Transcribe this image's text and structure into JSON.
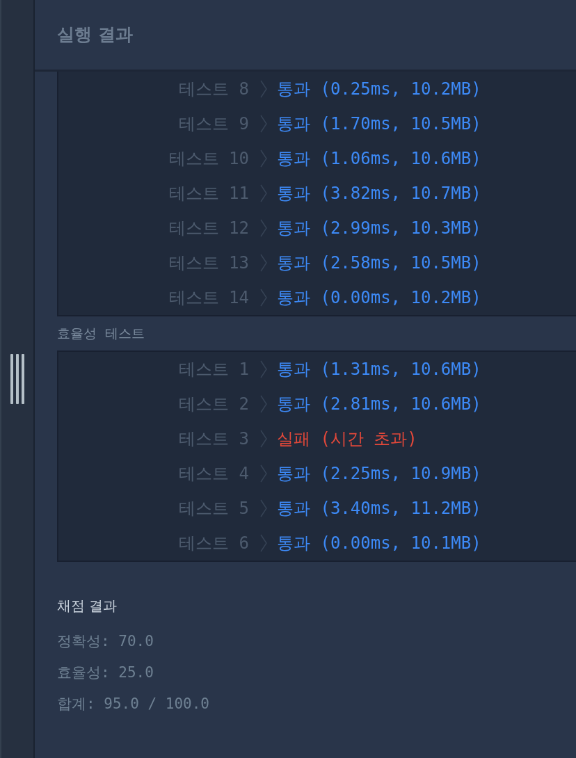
{
  "panel_title": "실행 결과",
  "accuracy_tests": [
    {
      "label": "테스트 8",
      "result": "통과 (0.25ms, 10.2MB)",
      "kind": "pass"
    },
    {
      "label": "테스트 9",
      "result": "통과 (1.70ms, 10.5MB)",
      "kind": "pass"
    },
    {
      "label": "테스트 10",
      "result": "통과 (1.06ms, 10.6MB)",
      "kind": "pass"
    },
    {
      "label": "테스트 11",
      "result": "통과 (3.82ms, 10.7MB)",
      "kind": "pass"
    },
    {
      "label": "테스트 12",
      "result": "통과 (2.99ms, 10.3MB)",
      "kind": "pass"
    },
    {
      "label": "테스트 13",
      "result": "통과 (2.58ms, 10.5MB)",
      "kind": "pass"
    },
    {
      "label": "테스트 14",
      "result": "통과 (0.00ms, 10.2MB)",
      "kind": "pass"
    }
  ],
  "efficiency_heading": "효율성  테스트",
  "efficiency_tests": [
    {
      "label": "테스트 1",
      "result": "통과 (1.31ms, 10.6MB)",
      "kind": "pass"
    },
    {
      "label": "테스트 2",
      "result": "통과 (2.81ms, 10.6MB)",
      "kind": "pass"
    },
    {
      "label": "테스트 3",
      "result": "실패 (시간 초과)",
      "kind": "fail"
    },
    {
      "label": "테스트 4",
      "result": "통과 (2.25ms, 10.9MB)",
      "kind": "pass"
    },
    {
      "label": "테스트 5",
      "result": "통과 (3.40ms, 11.2MB)",
      "kind": "pass"
    },
    {
      "label": "테스트 6",
      "result": "통과 (0.00ms, 10.1MB)",
      "kind": "pass"
    }
  ],
  "grading": {
    "title": "채점 결과",
    "lines": [
      "정확성: 70.0",
      "효율성: 25.0",
      "합계: 95.0 / 100.0"
    ]
  }
}
